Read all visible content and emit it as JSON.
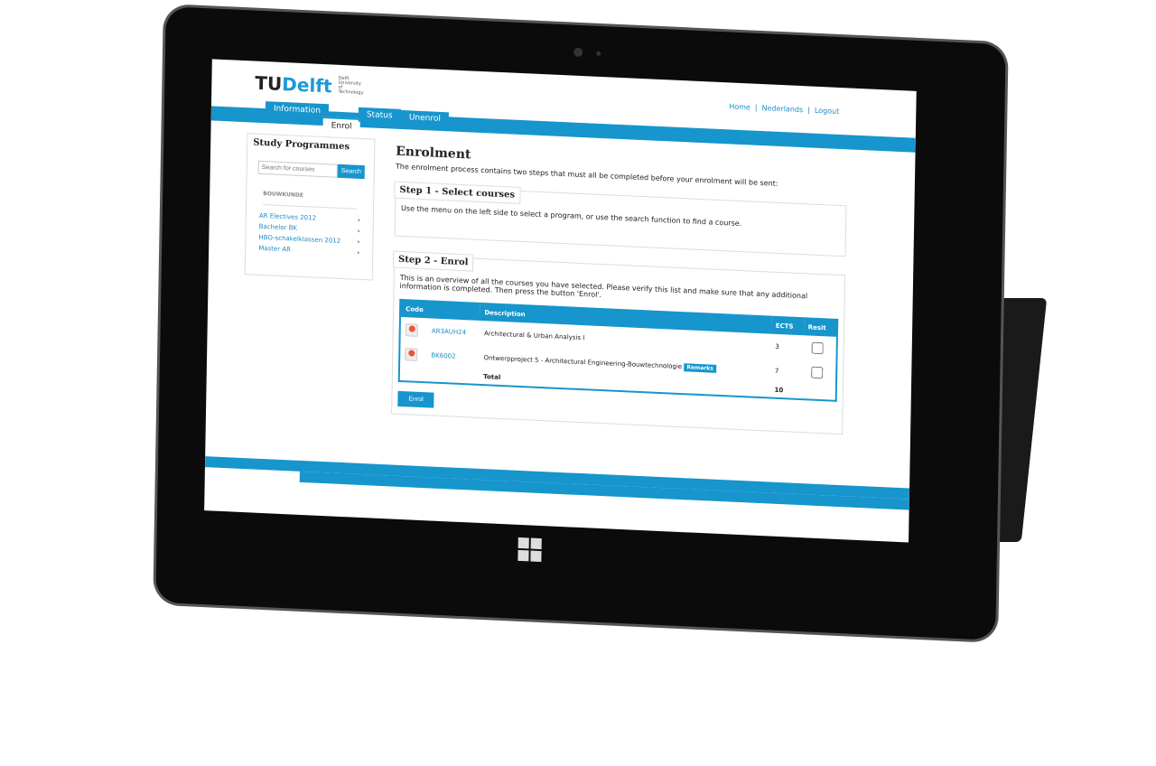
{
  "logo": {
    "tu": "TU",
    "delft": "Delft",
    "sub": "Delft University of Technology"
  },
  "toplinks": [
    "Home",
    "Nederlands",
    "Logout"
  ],
  "tabs": [
    "Information",
    "Enrol",
    "Status",
    "Unenrol"
  ],
  "sidebar": {
    "title": "Study Programmes",
    "search_placeholder": "Search for courses",
    "search_button": "Search",
    "section": "BOUWKUNDE",
    "programmes": [
      "AR Electives 2012",
      "Bachelor BK",
      "HBO-schakelklassen 2012",
      "Master AR"
    ]
  },
  "main": {
    "title": "Enrolment",
    "intro": "The enrolment process contains two steps that must all be completed before your enrolment will be sent:",
    "step1": {
      "title": "Step 1 - Select courses",
      "text": "Use the menu on the left side to select a program, or use the search function to find a course."
    },
    "step2": {
      "title": "Step 2 - Enrol",
      "text": "This is an overview of all the courses you have selected. Please verify this list and make sure that any additional information is completed. Then press the button 'Enrol'."
    },
    "table": {
      "headers": [
        "Code",
        "Description",
        "ECTS",
        "Resit"
      ],
      "rows": [
        {
          "code": "AR3AUH24",
          "description": "Architectural & Urban Analysis I",
          "ects": "3"
        },
        {
          "code": "BK6002",
          "description": "Ontwerpproject 5 - Architectural Engineering-Bouwtechnologie",
          "badge": "Remarks",
          "ects": "7"
        }
      ],
      "total_label": "Total",
      "total": "10"
    },
    "enrol_button": "Enrol"
  }
}
